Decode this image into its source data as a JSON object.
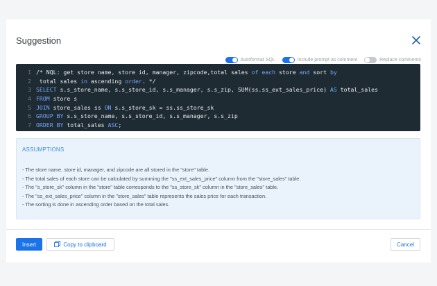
{
  "dialog": {
    "title": "Suggestion",
    "close_icon": "close-icon"
  },
  "toggles": [
    {
      "label": "Autoformat SQL",
      "on": true
    },
    {
      "label": "Include prompt as comment",
      "on": true
    },
    {
      "label": "Replace comments",
      "on": false
    }
  ],
  "code_lines": [
    {
      "num": "1",
      "parts": [
        [
          "cm",
          "/* NQL: get store name, store id, manager, zipcode,total sales "
        ],
        [
          "kw",
          "of each"
        ],
        [
          "cm",
          " store "
        ],
        [
          "kw",
          "and"
        ],
        [
          "cm",
          " sort "
        ],
        [
          "kw",
          "by"
        ]
      ]
    },
    {
      "num": "2",
      "parts": [
        [
          "cm",
          " total sales "
        ],
        [
          "kw",
          "in"
        ],
        [
          "cm",
          " ascending "
        ],
        [
          "kw",
          "order"
        ],
        [
          "cm",
          ". */"
        ]
      ]
    },
    {
      "num": "3",
      "parts": [
        [
          "kw",
          "SELECT"
        ],
        [
          "cm",
          " s.s_store_name, s.s_store_id, s.s_manager, s.s_zip, SUM(ss.ss_ext_sales_price) "
        ],
        [
          "kw",
          "AS"
        ],
        [
          "cm",
          " total_sales"
        ]
      ]
    },
    {
      "num": "4",
      "parts": [
        [
          "kw",
          "FROM"
        ],
        [
          "cm",
          " store s"
        ]
      ]
    },
    {
      "num": "5",
      "parts": [
        [
          "kw",
          "JOIN"
        ],
        [
          "cm",
          " store_sales ss "
        ],
        [
          "kw",
          "ON"
        ],
        [
          "cm",
          " s.s_store_sk = ss.ss_store_sk"
        ]
      ]
    },
    {
      "num": "6",
      "parts": [
        [
          "kw",
          "GROUP BY"
        ],
        [
          "cm",
          " s.s_store_name, s.s_store_id, s.s_manager, s.s_zip"
        ]
      ]
    },
    {
      "num": "7",
      "parts": [
        [
          "kw",
          "ORDER BY"
        ],
        [
          "cm",
          " total_sales "
        ],
        [
          "kw",
          "ASC"
        ],
        [
          "cm",
          ";"
        ]
      ]
    }
  ],
  "assumptions": {
    "title": "ASSUMPTIONS",
    "items": [
      "- The store name, store id, manager, and zipcode are all stored in the \"store\" table.",
      "- The total sales of each store can be calculated by summing the \"ss_ext_sales_price\" column from the \"store_sales\" table.",
      "- The \"s_store_sk\" column in the \"store\" table corresponds to the \"ss_store_sk\" column in the \"store_sales\" table.",
      "- The \"ss_ext_sales_price\" column in the \"store_sales\" table represents the sales price for each transaction.",
      "- The sorting is done in ascending order based on the total sales."
    ]
  },
  "footer": {
    "insert_label": "Insert",
    "copy_label": "Copy to clipboard",
    "cancel_label": "Cancel"
  },
  "colors": {
    "accent": "#1a73e8",
    "code_bg": "#1f2b33",
    "assumptions_bg": "#eaf3fc"
  }
}
